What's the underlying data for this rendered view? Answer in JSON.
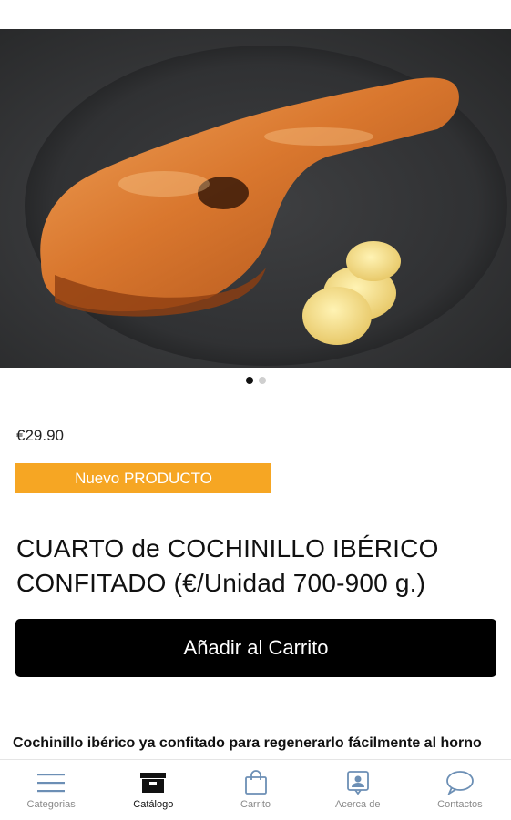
{
  "product": {
    "image_alt": "Cuarto de cochinillo ibérico confitado",
    "slide_count": 2,
    "active_slide": 1,
    "price": "€29.90",
    "badge": "Nuevo PRODUCTO",
    "title_line1": "CUARTO de COCHINILLO IBÉRICO",
    "title_line2": "CONFITADO  (€/Unidad 700-900 g.)",
    "add_to_cart_label": "Añadir al Carrito",
    "description": "Cochinillo ibérico ya confitado para regenerarlo fácilmente al horno"
  },
  "tabbar": {
    "items": [
      {
        "label": "Categorias",
        "icon": "menu-icon",
        "active": false
      },
      {
        "label": "Catálogo",
        "icon": "box-icon",
        "active": true
      },
      {
        "label": "Carrito",
        "icon": "shopping-bag-icon",
        "active": false
      },
      {
        "label": "Acerca de",
        "icon": "contact-card-icon",
        "active": false
      },
      {
        "label": "Contactos",
        "icon": "chat-bubble-icon",
        "active": false
      }
    ]
  },
  "colors": {
    "badge": "#f6a623",
    "button": "#000000",
    "tab_inactive": "#8a8a8a",
    "tab_icon_inactive": "#6c8fb5"
  }
}
